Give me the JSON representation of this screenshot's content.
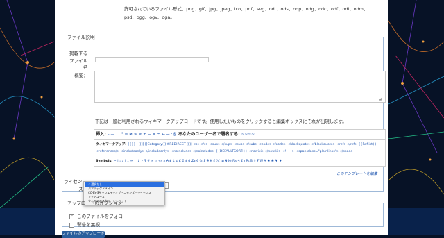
{
  "formats_text": "許可されているファイル形式：png、gif、jpg、jpeg、ico、pdf、svg、odt、ods、odp、odg、odc、odf、odi、odm、psd、ogg、ogv、oga。",
  "description_section": {
    "legend": "ファイル説明",
    "publish_label": "掲載する",
    "file_name_label": "ファイル名",
    "file_name_label_part1": "ファイル",
    "file_name_label_part2": "名",
    "file_name_value": "",
    "summary_label": "概要：",
    "summary_value": "",
    "help_text": "下記は一般に利用されるウィキマークアップコードです。使用したいものをクリックすると編集ボックスにそれが出現します。",
    "wikimarkup": {
      "insert_prefix": "挿入:",
      "insert_chars": " – — … ° ≈ ≠ ≤ ≥ ± − × ÷ ← → · §",
      "signature_label": "あなたのユーザー名で署名する:",
      "signature_code": "~~~~",
      "markup_label": "ウィキマークアップ:",
      "markup_codes": "{{}}  |  [[]]  [[Category:]]  #REDIRECT [[]]  <s></s>  <sup></sup>  <sub></sub>  <code></code>  <blockquote></blockquote>  <ref></ref>  {{Reflist}}  <references/>  <includeonly></includeonly>  <noinclude></noinclude>  {{DEFAULTSORT:}}  <nowiki></nowiki>  <!-- -->  <span class=\"plainlinks\"></span>",
      "symbols_label": "Symbols:",
      "symbols_chars": "~ | ¡ ¿ † ‡ ↔ ↑ ↓ • ¶ # ∞ ‹› «» ¤ ₳ ฿ ₵ ¢ ₡ ₢ $ ₫ ₯ € ₠ ₣ ₴ ₭ ₤ ℳ ₥ ₦ № ₧ ₰ £ ៛ ₨ ₪ ৳ ₮ ₩ ¥ ♠ ♣ ♥ ♦"
    },
    "template_link": "このテンプレートを編集",
    "license_label_part1": "ライセン",
    "license_label_part2": "ス",
    "license_options": [
      "選択なし",
      "パブリックドメイン",
      "CC-BY-SA クリエイティブ・コモンズ・ライセンス",
      "フェアユース",
      "ウィキアのスクリーンショット"
    ],
    "license_selected": "選択なし"
  },
  "upload_options": {
    "legend": "アップロードのオプション",
    "follow_label": "このファイルをフォロー",
    "follow_checked": true,
    "ignore_warnings_label": "警告を無視",
    "ignore_warnings_checked": false
  },
  "upload_button_label": "ファイルのアップロード",
  "colors": {
    "background": "#071226",
    "fieldset_border": "#9fb9d8",
    "link": "#1f56b0",
    "selected_option": "#2b6fe0",
    "upload_button": "#2a5e9c"
  }
}
